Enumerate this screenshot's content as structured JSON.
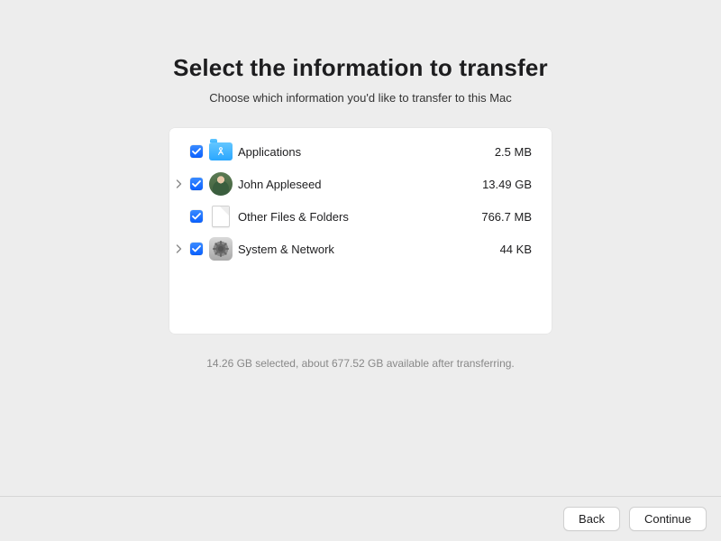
{
  "title": "Select the information to transfer",
  "subtitle": "Choose which information you'd like to transfer to this Mac",
  "items": [
    {
      "label": "Applications",
      "size": "2.5 MB",
      "checked": true,
      "expandable": false,
      "icon": "app"
    },
    {
      "label": "John Appleseed",
      "size": "13.49 GB",
      "checked": true,
      "expandable": true,
      "icon": "avatar"
    },
    {
      "label": "Other Files & Folders",
      "size": "766.7 MB",
      "checked": true,
      "expandable": false,
      "icon": "doc"
    },
    {
      "label": "System & Network",
      "size": "44 KB",
      "checked": true,
      "expandable": true,
      "icon": "gear"
    }
  ],
  "summary": "14.26 GB selected, about 677.52 GB available after transferring.",
  "buttons": {
    "back": "Back",
    "continue": "Continue"
  }
}
